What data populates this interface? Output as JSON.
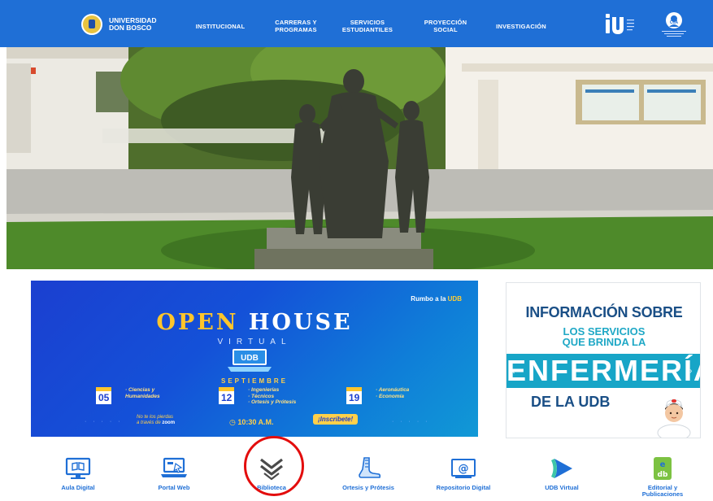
{
  "header": {
    "brand": "UNIVERSIDAD DON BOSCO",
    "nav": [
      {
        "label": "INSTITUCIONAL"
      },
      {
        "label": "CARRERAS Y PROGRAMAS"
      },
      {
        "label": "SERVICIOS ESTUDIANTILES"
      },
      {
        "label": "PROYECCIÓN SOCIAL"
      },
      {
        "label": "INVESTIGACIÓN"
      }
    ]
  },
  "hero": {
    "alt": ""
  },
  "openhouse": {
    "rumbo": "Rumbo a la",
    "rumbo_highlight": "UDB",
    "title_word1": "OPEN",
    "title_word2": "HOUSE",
    "virtual": "VIRTUAL",
    "udb": "UDB",
    "month": "SEPTIEMBRE",
    "days": [
      {
        "day": "05",
        "lines": [
          "· Ciencias y",
          "  Humanidades"
        ]
      },
      {
        "day": "12",
        "lines": [
          "· Ingenierías",
          "· Técnicos",
          "· Ortesis y Prótesis"
        ]
      },
      {
        "day": "19",
        "lines": [
          "· Aeronáutica",
          "· Economía"
        ]
      }
    ],
    "zoom_line1": "No te los pierdas",
    "zoom_line2": "a través de",
    "zoom_brand": "zoom",
    "time": "10:30 A.M.",
    "cta": "¡Inscríbete!"
  },
  "enfermeria": {
    "line1": "INFORMACIÓN SOBRE",
    "line2a": "LOS SERVICIOS",
    "line2b": "QUE BRINDA LA",
    "line3": "ENFERMERÍA",
    "line4": "DE LA UDB"
  },
  "quick_links": [
    {
      "label": "Aula Digital",
      "icon": "monitor-book-icon"
    },
    {
      "label": "Portal Web",
      "icon": "laptop-cursor-icon"
    },
    {
      "label": "Biblioteca",
      "icon": "book-chevron-icon"
    },
    {
      "label": "Ortesis y Prótesis",
      "icon": "foot-prosthesis-icon"
    },
    {
      "label": "Repositorio Digital",
      "icon": "at-folder-icon"
    },
    {
      "label": "UDB Virtual",
      "icon": "play-arrow-icon"
    },
    {
      "label": "Editorial y Publicaciones",
      "icon": "eudb-logo-icon"
    }
  ],
  "colors": {
    "nav_blue": "#1f6fd6",
    "link_blue": "#1f6fd6",
    "highlight_red": "#e30d0d",
    "enfermeria_teal": "#17a5c7",
    "openhouse_gold": "#ffc52b"
  }
}
